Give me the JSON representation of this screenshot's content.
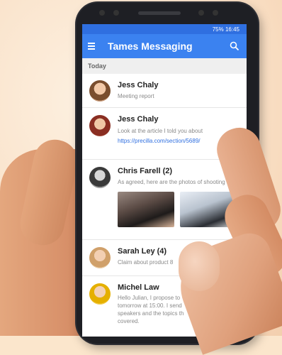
{
  "status_bar": {
    "text": "75% 16:45"
  },
  "app": {
    "title": "Tames Messaging"
  },
  "section": {
    "label": "Today"
  },
  "messages": [
    {
      "name": "Jess Chaly",
      "preview": "Meeting report"
    },
    {
      "name": "Jess Chaly",
      "preview": "Look at the article I told you about",
      "link": "https://precilla.com/section/5689/"
    },
    {
      "name": "Chris Farell (2)",
      "preview": "As agreed, here are the photos of shooting"
    },
    {
      "name": "Sarah Ley (4)",
      "preview": "Claim about product 8"
    },
    {
      "name": "Michel Law",
      "preview_lines": [
        "Hello Julian, I propose to",
        "tomorrow at 15:00. I send",
        "speakers and the topics th",
        "covered."
      ]
    }
  ],
  "colors": {
    "accent": "#3b82f0",
    "status": "#2f6fe0",
    "link": "#2f6fe0"
  },
  "icons": {
    "menu": "menu-icon",
    "search": "search-icon",
    "attach": "attach-icon"
  }
}
